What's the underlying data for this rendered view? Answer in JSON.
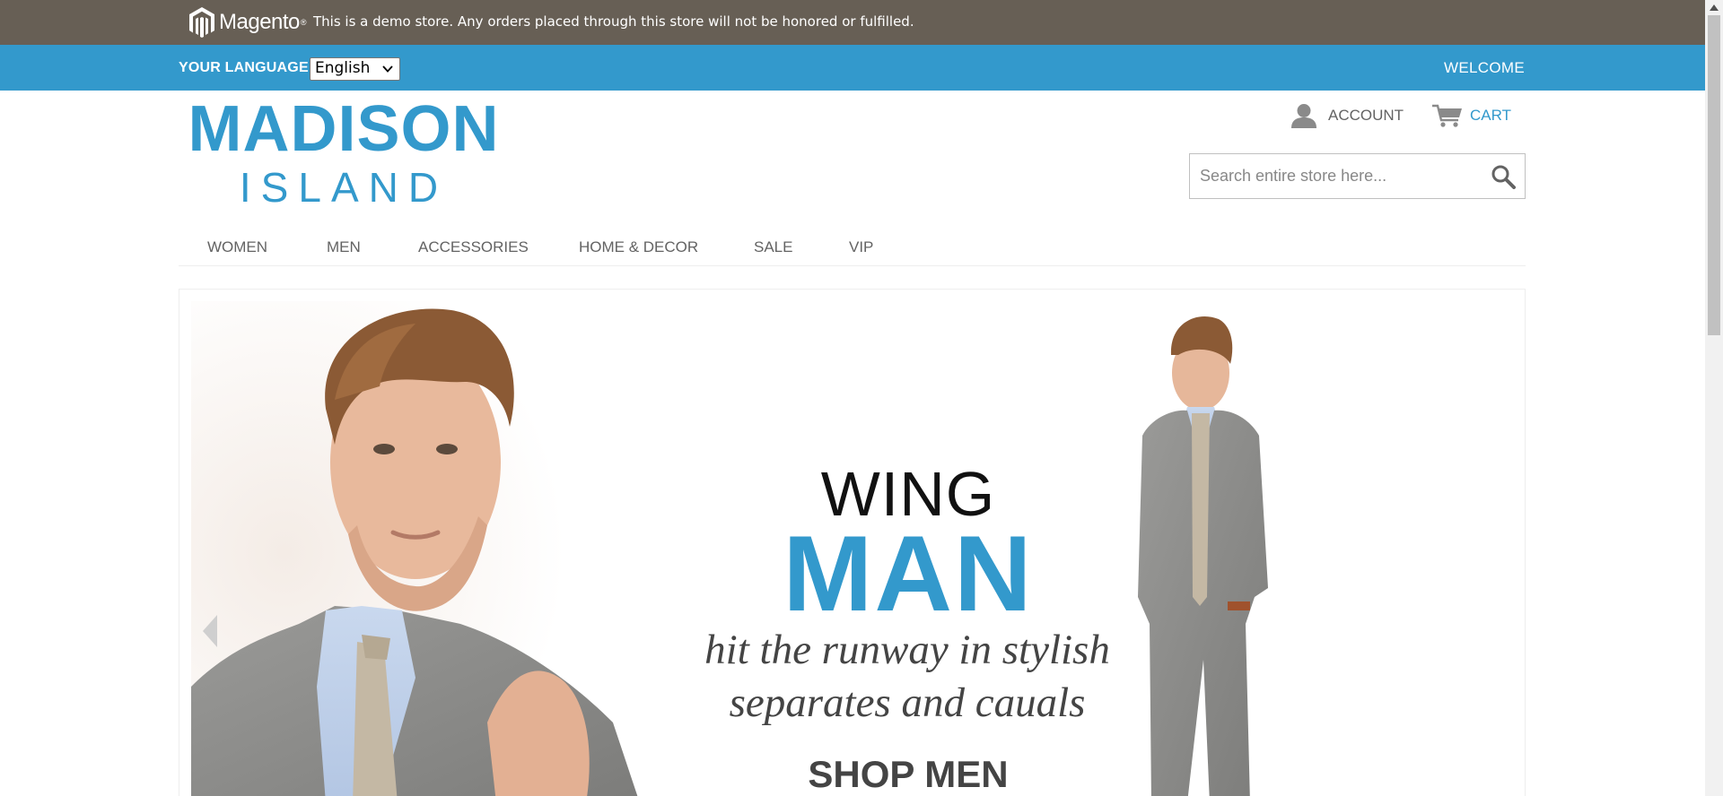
{
  "demo_notice": {
    "brand": "Magento",
    "message": "This is a demo store. Any orders placed through this store will not be honored or fulfilled."
  },
  "language_bar": {
    "label": "Your Language:",
    "selected": "English",
    "welcome": "Welcome"
  },
  "header": {
    "logo_line1": "MADISON",
    "logo_line2": "ISLAND",
    "account_label": "Account",
    "cart_label": "Cart",
    "search_placeholder": "Search entire store here..."
  },
  "nav": {
    "items": [
      {
        "label": "Women"
      },
      {
        "label": "Men"
      },
      {
        "label": "Accessories"
      },
      {
        "label": "Home & Decor"
      },
      {
        "label": "Sale"
      },
      {
        "label": "VIP"
      }
    ]
  },
  "hero": {
    "line1": "WING",
    "line2": "MAN",
    "subtitle_line1": "hit the runway in stylish",
    "subtitle_line2": "separates and cauals",
    "cta": "SHOP MEN"
  },
  "colors": {
    "notice_bg": "#675f55",
    "accent": "#3399cc",
    "text": "#636363"
  },
  "icons": {
    "account": "user-icon",
    "cart": "cart-icon",
    "search": "search-icon",
    "slider_prev": "chevron-left-icon",
    "logo": "magento-logo"
  }
}
